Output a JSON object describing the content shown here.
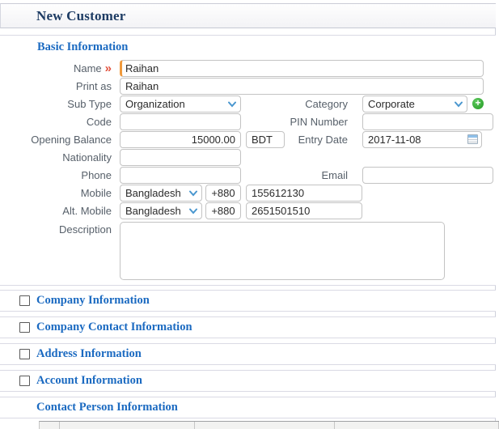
{
  "page": {
    "title": "New Customer"
  },
  "sections": {
    "basic": {
      "title": "Basic Information"
    },
    "collapsed": [
      {
        "label": "Company Information",
        "checkbox": true
      },
      {
        "label": "Company Contact Information",
        "checkbox": true
      },
      {
        "label": "Address Information",
        "checkbox": true
      },
      {
        "label": "Account Information",
        "checkbox": true
      },
      {
        "label": "Contact Person Information",
        "checkbox": false
      }
    ]
  },
  "fields": {
    "name": {
      "label": "Name",
      "required_marker": "»",
      "value": "Raihan"
    },
    "print_as": {
      "label": "Print as",
      "value": "Raihan"
    },
    "sub_type": {
      "label": "Sub Type",
      "value": "Organization"
    },
    "category": {
      "label": "Category",
      "value": "Corporate"
    },
    "code": {
      "label": "Code",
      "value": ""
    },
    "pin_number": {
      "label": "PIN Number",
      "value": ""
    },
    "opening_balance": {
      "label": "Opening Balance",
      "value": "15000.00",
      "currency_code": "BDT"
    },
    "entry_date": {
      "label": "Entry Date",
      "value": "2017-11-08"
    },
    "nationality": {
      "label": "Nationality",
      "value": ""
    },
    "phone": {
      "label": "Phone",
      "value": ""
    },
    "email": {
      "label": "Email",
      "value": ""
    },
    "mobile": {
      "label": "Mobile",
      "country": "Bangladesh",
      "dial_code": "+880",
      "number": "155612130"
    },
    "alt_mobile": {
      "label": "Alt. Mobile",
      "country": "Bangladesh",
      "dial_code": "+880",
      "number": "2651501510"
    },
    "description": {
      "label": "Description",
      "value": ""
    }
  },
  "add_category_label": "+",
  "contact_person_table": {
    "visible_header_columns": 4,
    "header_labels": [
      "",
      "",
      "",
      ""
    ]
  },
  "colors": {
    "page_title_navy": "#1e3c64",
    "section_title_blue": "#1b6ac1",
    "required_marker_red": "#e2513c",
    "required_field_border_orange": "#f09a3d",
    "add_button_green": "#2fa838",
    "select_chevron_blue": "#4a97cf"
  }
}
